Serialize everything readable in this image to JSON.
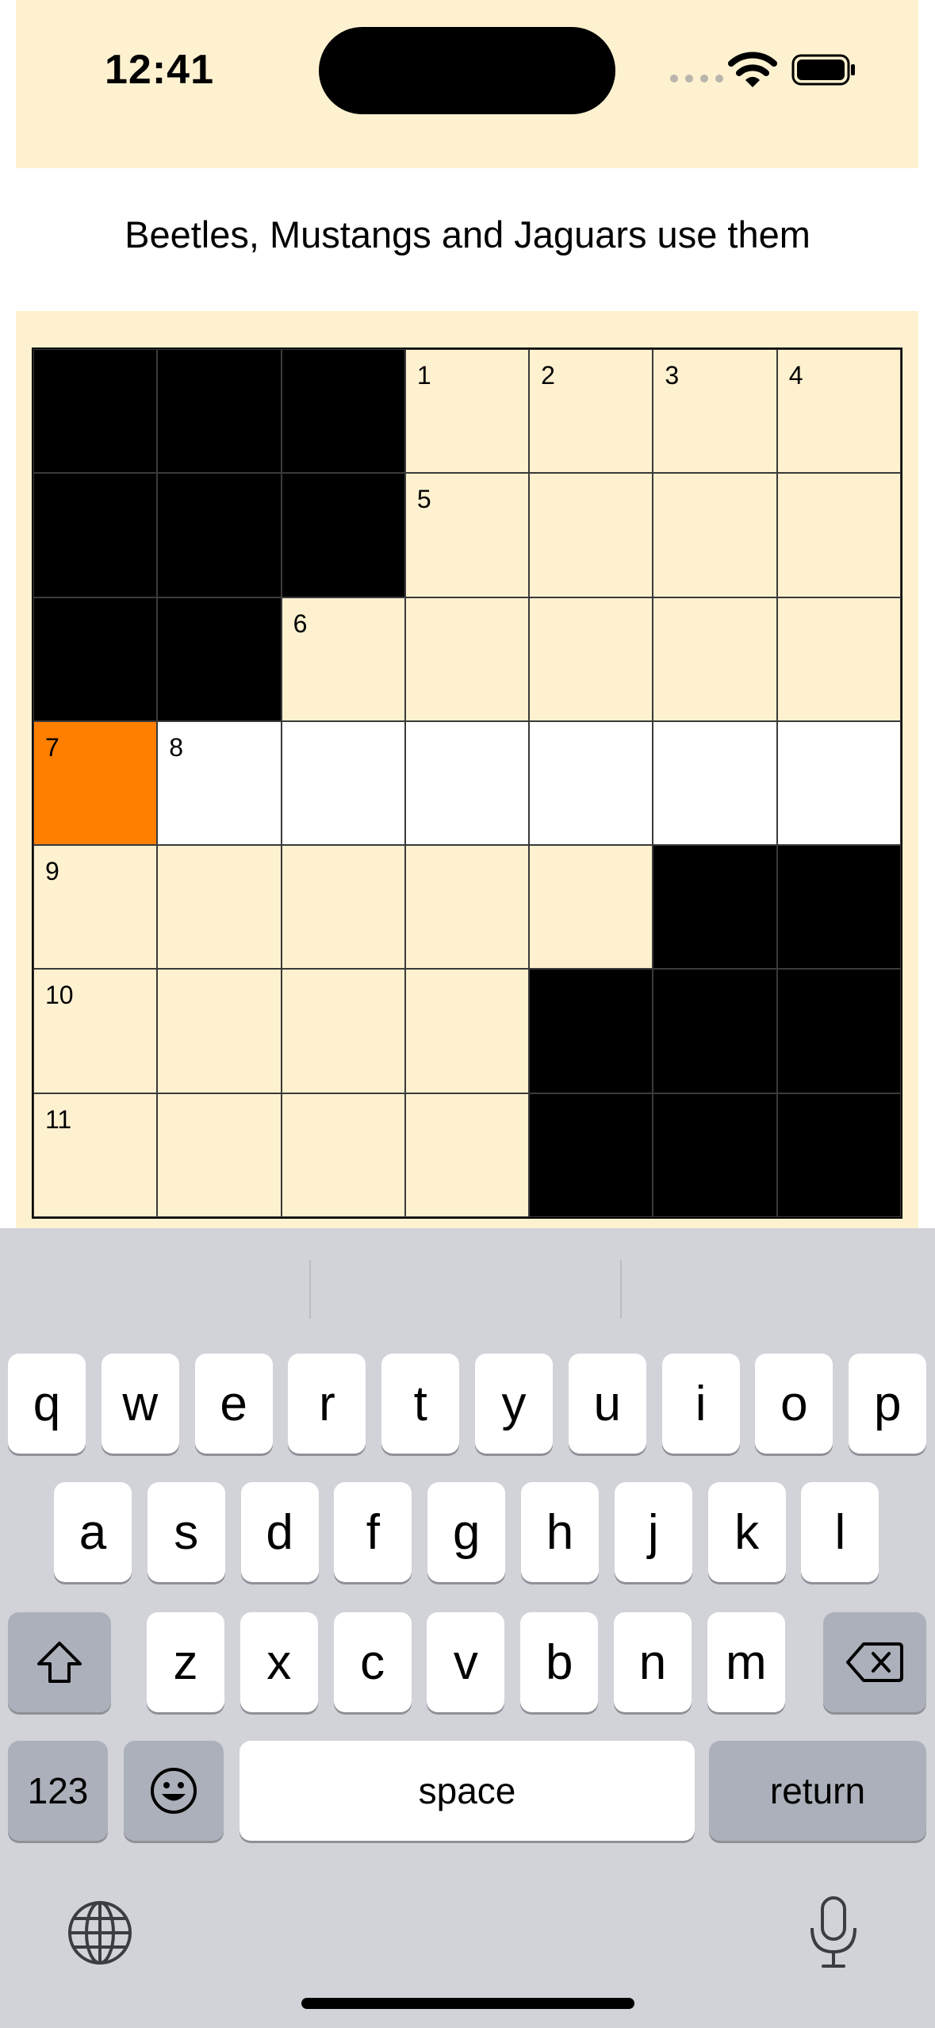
{
  "status_bar": {
    "time": "12:41"
  },
  "clue": {
    "text": "Beetles, Mustangs and Jaguars use them"
  },
  "crossword": {
    "rows": [
      [
        {
          "t": "b"
        },
        {
          "t": "b"
        },
        {
          "t": "b"
        },
        {
          "t": "o",
          "n": "1"
        },
        {
          "t": "o",
          "n": "2"
        },
        {
          "t": "o",
          "n": "3"
        },
        {
          "t": "o",
          "n": "4"
        }
      ],
      [
        {
          "t": "b"
        },
        {
          "t": "b"
        },
        {
          "t": "b"
        },
        {
          "t": "o",
          "n": "5"
        },
        {
          "t": "o"
        },
        {
          "t": "o"
        },
        {
          "t": "o"
        }
      ],
      [
        {
          "t": "b"
        },
        {
          "t": "b"
        },
        {
          "t": "o",
          "n": "6"
        },
        {
          "t": "o"
        },
        {
          "t": "o"
        },
        {
          "t": "o"
        },
        {
          "t": "o"
        }
      ],
      [
        {
          "t": "s",
          "n": "7"
        },
        {
          "t": "w",
          "n": "8"
        },
        {
          "t": "w"
        },
        {
          "t": "w"
        },
        {
          "t": "w"
        },
        {
          "t": "w"
        },
        {
          "t": "w"
        }
      ],
      [
        {
          "t": "o",
          "n": "9"
        },
        {
          "t": "o"
        },
        {
          "t": "o"
        },
        {
          "t": "o"
        },
        {
          "t": "o"
        },
        {
          "t": "b"
        },
        {
          "t": "b"
        }
      ],
      [
        {
          "t": "o",
          "n": "10"
        },
        {
          "t": "o"
        },
        {
          "t": "o"
        },
        {
          "t": "o"
        },
        {
          "t": "b"
        },
        {
          "t": "b"
        },
        {
          "t": "b"
        }
      ],
      [
        {
          "t": "o",
          "n": "11"
        },
        {
          "t": "o"
        },
        {
          "t": "o"
        },
        {
          "t": "o"
        },
        {
          "t": "b"
        },
        {
          "t": "b"
        },
        {
          "t": "b"
        }
      ]
    ],
    "colors": {
      "open": "#fdf1d0",
      "active_word": "#ffffff",
      "selected": "#ff7f00",
      "block": "#000000"
    }
  },
  "keyboard": {
    "row1": [
      "q",
      "w",
      "e",
      "r",
      "t",
      "y",
      "u",
      "i",
      "o",
      "p"
    ],
    "row2": [
      "a",
      "s",
      "d",
      "f",
      "g",
      "h",
      "j",
      "k",
      "l"
    ],
    "row3": [
      "z",
      "x",
      "c",
      "v",
      "b",
      "n",
      "m"
    ],
    "numbers_label": "123",
    "space_label": "space",
    "return_label": "return",
    "icons": [
      "shift-icon",
      "delete-icon",
      "emoji-icon",
      "globe-icon",
      "mic-icon"
    ]
  }
}
